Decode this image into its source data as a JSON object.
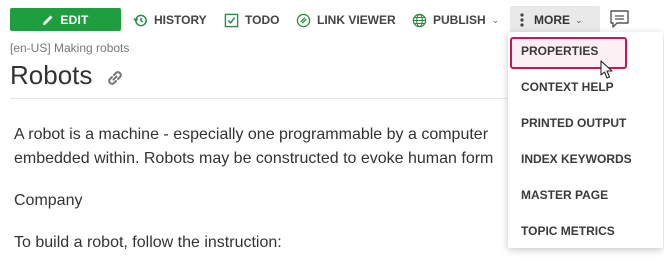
{
  "toolbar": {
    "edit_label": "EDIT",
    "history_label": "HISTORY",
    "todo_label": "TODO",
    "link_viewer_label": "LINK VIEWER",
    "publish_label": "PUBLISH",
    "more_label": "MORE"
  },
  "breadcrumb": "[en-US] Making robots",
  "page_title": "Robots",
  "content": {
    "para1_line1": "A robot is a machine - especially one programmable by a computer",
    "para1_line2": "embedded within. Robots may be constructed to evoke human form",
    "para2": "Company",
    "para3": "To build a robot, follow the instruction:"
  },
  "more_menu": {
    "items": [
      {
        "label": "PROPERTIES",
        "active": true
      },
      {
        "label": "CONTEXT HELP"
      },
      {
        "label": "PRINTED OUTPUT"
      },
      {
        "label": "INDEX KEYWORDS"
      },
      {
        "label": "MASTER PAGE"
      },
      {
        "label": "TOPIC METRICS"
      }
    ]
  },
  "colors": {
    "edit_green": "#1e9e3f",
    "icon_green": "#2e8b4a",
    "active_border": "#c2185b",
    "more_bg": "#e9e9e9"
  },
  "icons": [
    "pencil-icon",
    "history-icon",
    "checkbox-icon",
    "link-viewer-icon",
    "globe-icon",
    "vertical-dots-icon",
    "comment-icon",
    "link-icon",
    "mouse-cursor-icon"
  ]
}
